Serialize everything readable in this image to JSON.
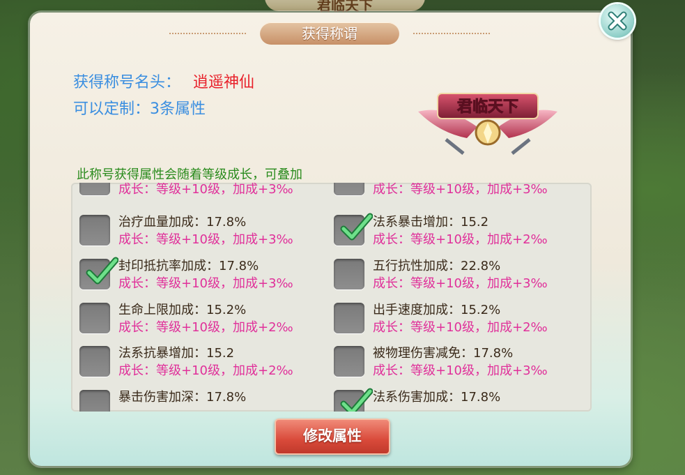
{
  "background": {
    "banner_text": "君临天下"
  },
  "dialog": {
    "title": "获得称谓",
    "title_label": "获得称号名头：",
    "title_name": "逍遥神仙",
    "custom_label": "可以定制：3条属性",
    "emblem_text": "君临天下",
    "hint": "此称号获得属性会随着等级成长，可叠加",
    "modify_button": "修改属性"
  },
  "attributes": [
    {
      "name": "",
      "growth": "成长：等级+10级，加成+3‰",
      "checked": false
    },
    {
      "name": "",
      "growth": "成长：等级+10级，加成+3‰",
      "checked": false
    },
    {
      "name": "治疗血量加成：17.8%",
      "growth": "成长：等级+10级，加成+3‰",
      "checked": false
    },
    {
      "name": "法系暴击增加：15.2",
      "growth": "成长：等级+10级，加成+2‰",
      "checked": true
    },
    {
      "name": "封印抵抗率加成：17.8%",
      "growth": "成长：等级+10级，加成+3‰",
      "checked": true
    },
    {
      "name": "五行抗性加成：22.8%",
      "growth": "成长：等级+10级，加成+3‰",
      "checked": false
    },
    {
      "name": "生命上限加成：15.2%",
      "growth": "成长：等级+10级，加成+2‰",
      "checked": false
    },
    {
      "name": "出手速度加成：15.2%",
      "growth": "成长：等级+10级，加成+2‰",
      "checked": false
    },
    {
      "name": "法系抗暴增加：15.2",
      "growth": "成长：等级+10级，加成+2‰",
      "checked": false
    },
    {
      "name": "被物理伤害减免：17.8%",
      "growth": "成长：等级+10级，加成+3‰",
      "checked": false
    },
    {
      "name": "暴击伤害加深：17.8%",
      "growth": "",
      "checked": false
    },
    {
      "name": "法系伤害加成：17.8%",
      "growth": "",
      "checked": true
    }
  ],
  "colors": {
    "title_name": "#e8202a",
    "info_text": "#3a8ee0",
    "hint_text": "#2a8b1d",
    "growth_text": "#e0309a",
    "button": "#d94a3a"
  },
  "icons": {
    "close": "close-icon",
    "check": "check-icon"
  }
}
